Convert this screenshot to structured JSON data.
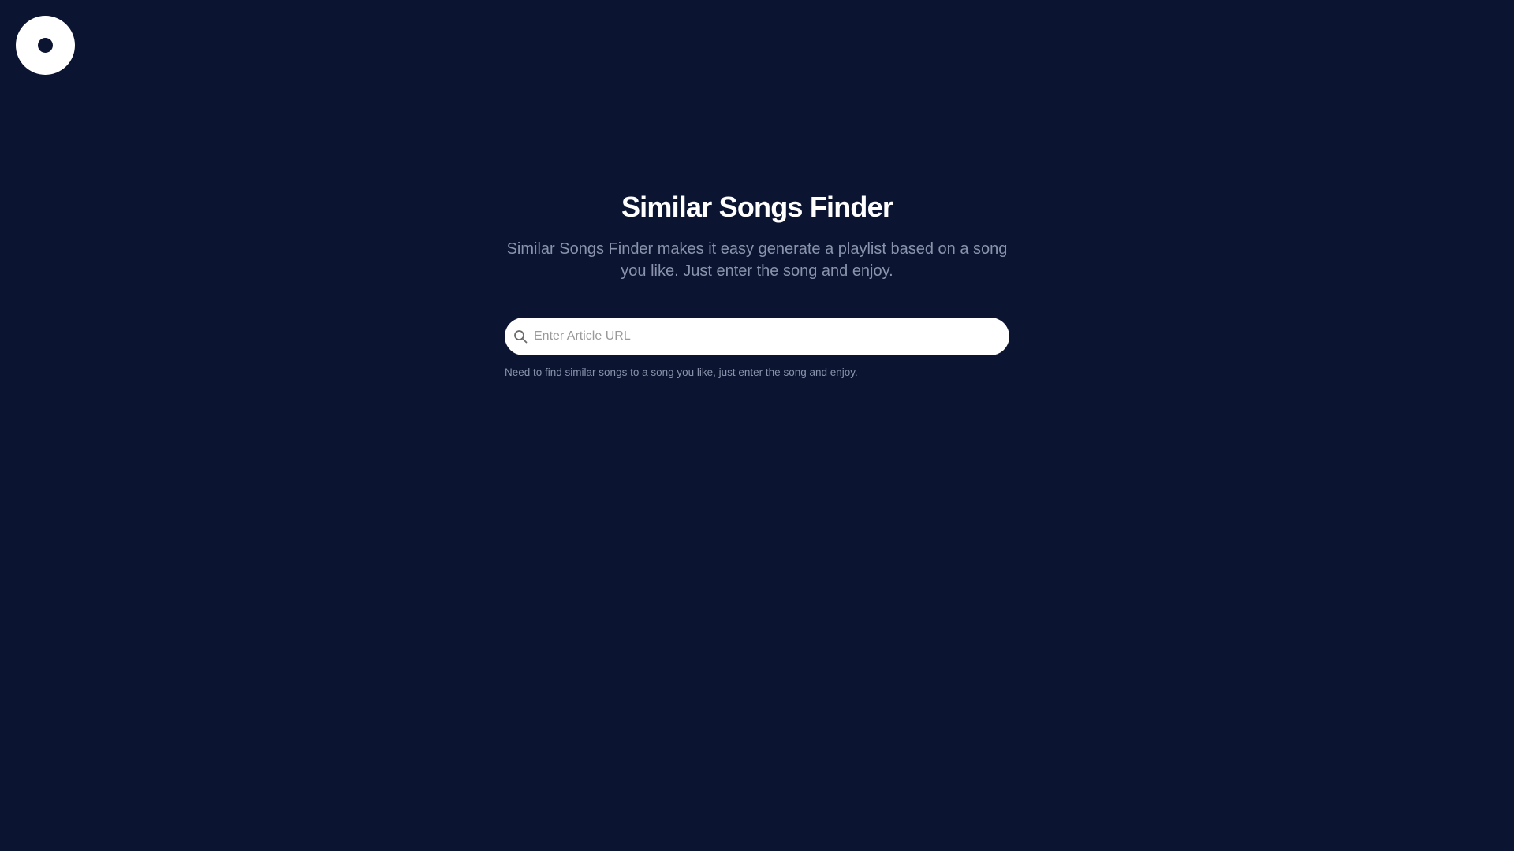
{
  "logo": {
    "icon": "disc-logo-icon"
  },
  "hero": {
    "title": "Similar Songs Finder",
    "subtitle": "Similar Songs Finder makes it easy generate a playlist based on a song you like. Just enter the song and enjoy."
  },
  "search": {
    "icon": "search-icon",
    "value": "",
    "placeholder": "Enter Article URL",
    "helper": "Need to find similar songs to a song you like, just enter the song and enjoy."
  },
  "colors": {
    "background": "#0b1430",
    "title": "#ffffff",
    "muted": "#8a93ab",
    "input_bg": "#ffffff"
  }
}
